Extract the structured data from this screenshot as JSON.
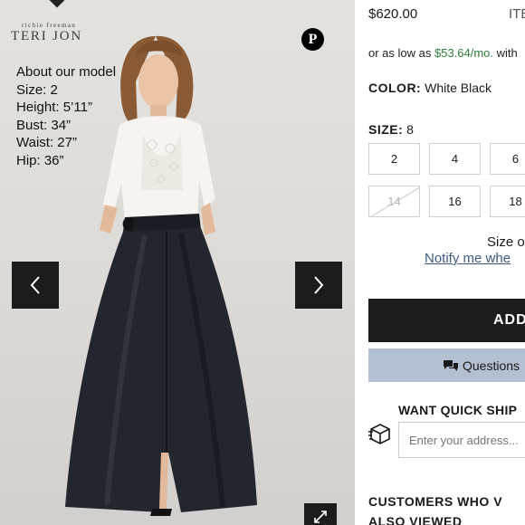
{
  "gallery": {
    "brand_small": "richie freeman",
    "brand_main": "TERI JON",
    "pinterest_glyph": "P",
    "model_info": {
      "heading": "About our model",
      "size": "Size: 2",
      "height": "Height: 5’11”",
      "bust": "Bust: 34”",
      "waist": "Waist: 27”",
      "hip": "Hip: 36”"
    },
    "icons": {
      "prev": "chevron-left-icon",
      "next": "chevron-right-icon",
      "expand": "expand-icon",
      "pinterest": "pinterest-icon"
    }
  },
  "product": {
    "price": "$620.00",
    "item_no": "ITE",
    "afford_prefix": "or as low as ",
    "afford_amount": "$53.64/mo.",
    "afford_suffix": " with",
    "color_label": "COLOR:",
    "color_value": "White Black",
    "size_label": "SIZE:",
    "size_value": "8",
    "sizes": [
      {
        "label": "2",
        "available": true
      },
      {
        "label": "4",
        "available": true
      },
      {
        "label": "6",
        "available": true
      },
      {
        "label": "14",
        "available": false
      },
      {
        "label": "16",
        "available": true
      },
      {
        "label": "18",
        "available": true
      }
    ],
    "size_out_text": "Size o",
    "notify_text": "Notify me whe",
    "add_button": "ADD",
    "questions_button": "Questions",
    "quick_ship_title": "WANT QUICK SHIP",
    "address_placeholder": "Enter your address...",
    "customers_also_line1": "CUSTOMERS WHO V",
    "customers_also_line2": "ALSO VIEWED"
  },
  "colors": {
    "dark_button": "#1c1c1c",
    "questions_button": "#b2c0d2",
    "link": "#3c5a84",
    "afford_amount": "#2f7d3a"
  }
}
